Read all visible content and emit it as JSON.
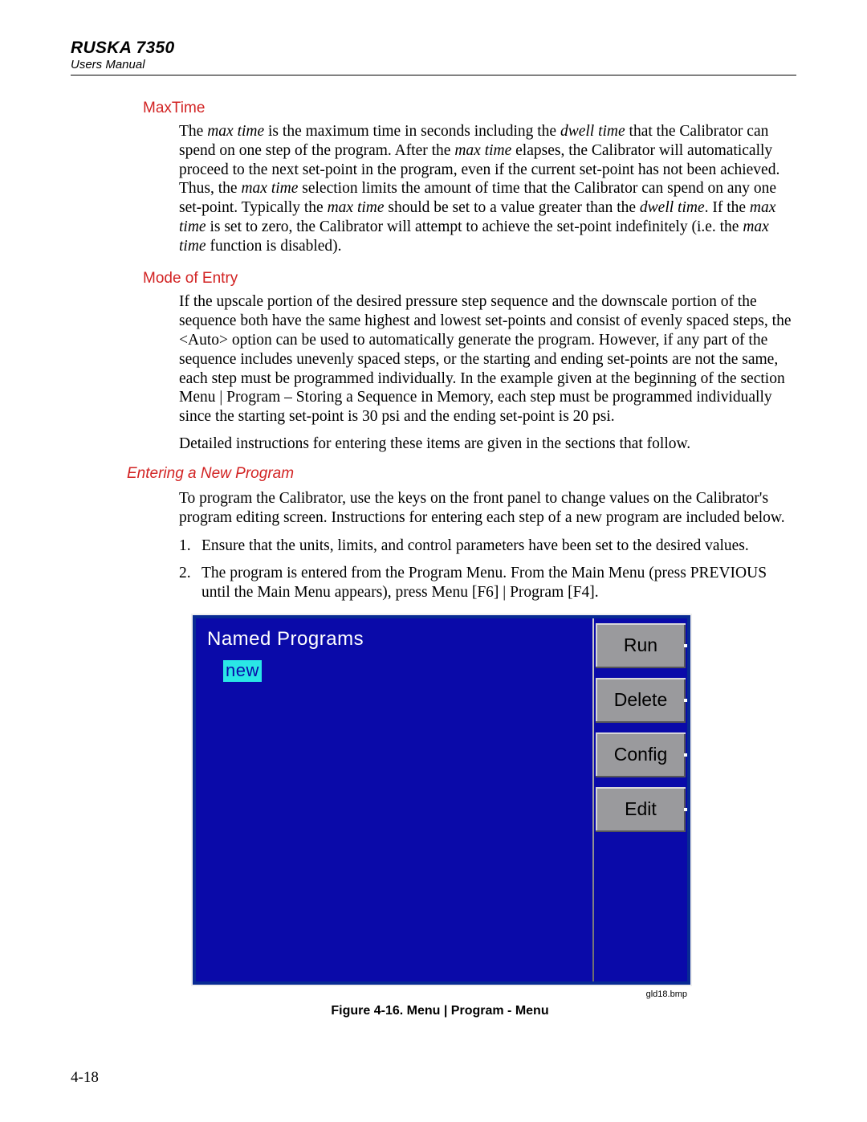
{
  "header": {
    "title": "RUSKA 7350",
    "subtitle": "Users Manual"
  },
  "sections": {
    "maxtime": {
      "heading": "MaxTime",
      "para_html": "The <i>max time</i> is the maximum time in seconds including the <i>dwell time</i> that the Calibrator can spend on one step of the program. After the <i>max time</i> elapses, the Calibrator will automatically proceed to the next set-point in the program, even if the current set-point has not been achieved. Thus, the <i>max time</i> selection limits the amount of time that the Calibrator can spend on any one set-point. Typically the <i>max time</i> should be set to a value greater than the <i>dwell time</i>. If the <i>max time</i> is set to zero, the Calibrator will attempt to achieve the set-point indefinitely (i.e. the <i>max time</i> function is disabled)."
    },
    "mode": {
      "heading": "Mode of Entry",
      "para1": "If the upscale portion of the desired pressure step sequence and the downscale portion of the sequence both have the same highest and lowest set-points and consist of evenly spaced steps, the <Auto> option can be used to automatically generate the program. However, if any part of the sequence includes unevenly spaced steps, or the starting and ending set-points are not the same, each step must be programmed individually. In the example given at the beginning of the section Menu | Program – Storing a Sequence in Memory, each step must be programmed individually since the starting set-point is 30 psi and the ending set-point is 20 psi.",
      "para2": "Detailed instructions for entering these items are given in the sections that follow."
    },
    "entering": {
      "heading": "Entering a New Program",
      "intro": "To program the Calibrator, use the keys on the front panel to change values on the Calibrator's program editing screen. Instructions for entering each step of a new program are included below.",
      "steps": [
        "Ensure that the units, limits, and control parameters have been set to the desired values.",
        "The program is entered from the Program Menu. From the Main Menu (press PREVIOUS until the Main Menu appears), press Menu [F6] | Program [F4]."
      ]
    }
  },
  "device_screen": {
    "title": "Named Programs",
    "selected_item": "new",
    "softkeys": [
      "Run",
      "Delete",
      "Config",
      "Edit"
    ]
  },
  "figure": {
    "image_label": "gld18.bmp",
    "caption": "Figure 4-16. Menu | Program - Menu"
  },
  "page_number": "4-18"
}
